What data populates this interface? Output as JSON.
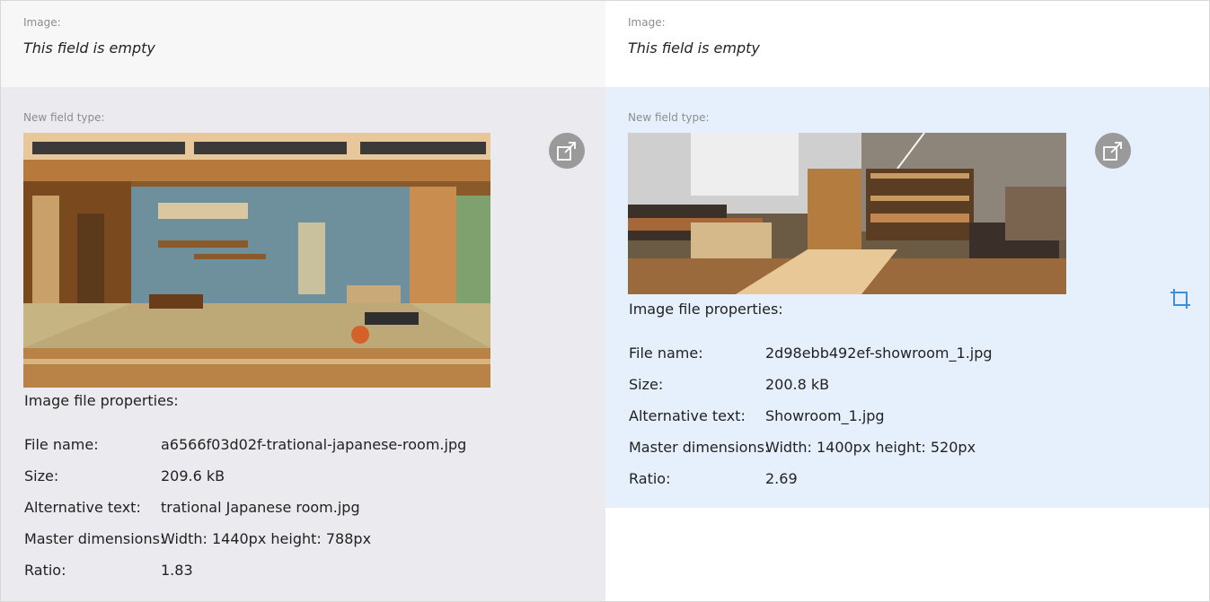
{
  "panels": [
    {
      "image_label": "Image:",
      "empty_text": "This field is empty",
      "new_field_label": "New field type:",
      "properties_heading": "Image file properties:",
      "properties": [
        {
          "key": "File name:",
          "value": "a6566f03d02f-trational-japanese-room.jpg"
        },
        {
          "key": "Size:",
          "value": "209.6 kB"
        },
        {
          "key": "Alternative text:",
          "value": "trational Japanese room.jpg"
        },
        {
          "key": "Master dimensions:",
          "value": "Width: 1440px height: 788px"
        },
        {
          "key": "Ratio:",
          "value": "1.83"
        }
      ],
      "expand_icon": "expand-icon"
    },
    {
      "image_label": "Image:",
      "empty_text": "This field is empty",
      "new_field_label": "New field type:",
      "properties_heading": "Image file properties:",
      "properties": [
        {
          "key": "File name:",
          "value": "2d98ebb492ef-showroom_1.jpg"
        },
        {
          "key": "Size:",
          "value": "200.8 kB"
        },
        {
          "key": "Alternative text:",
          "value": "Showroom_1.jpg"
        },
        {
          "key": "Master dimensions:",
          "value": "Width: 1400px height: 520px"
        },
        {
          "key": "Ratio:",
          "value": "2.69"
        }
      ],
      "expand_icon": "expand-icon",
      "crop_icon": "crop-icon"
    }
  ],
  "colors": {
    "left_top_bg": "#f7f7f7",
    "left_main_bg": "#ebeaef",
    "right_main_bg": "#e6f0fc",
    "icon_button_bg": "#9a9a9a",
    "crop_icon": "#3d8fd6"
  }
}
